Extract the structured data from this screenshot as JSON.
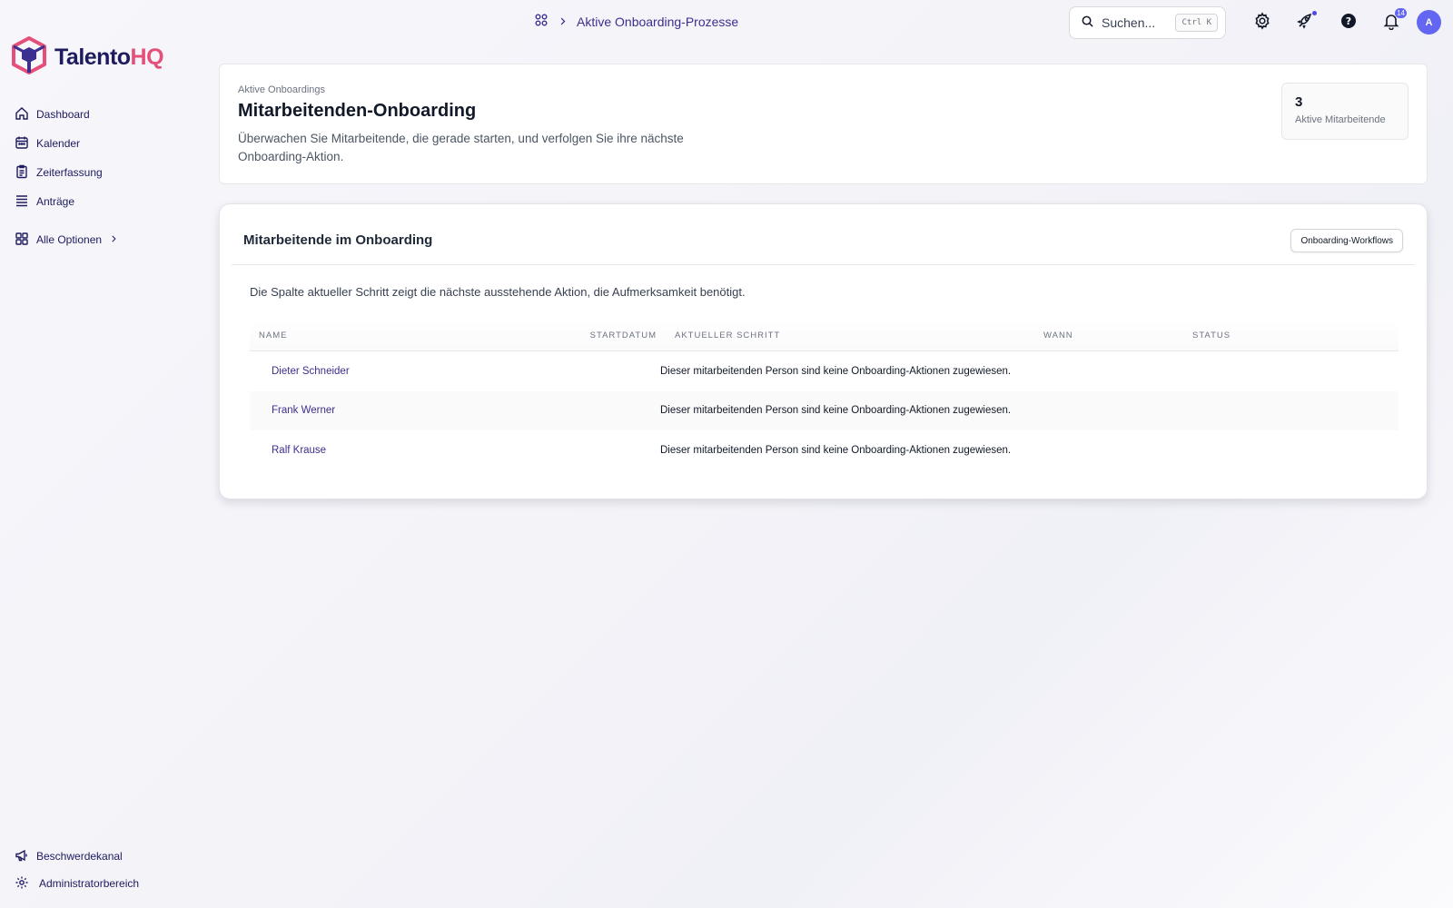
{
  "brand": {
    "name_part1": "Talento",
    "name_part2": "HQ",
    "primary": "#1e1b5e",
    "accent": "#e4507a"
  },
  "sidebar": {
    "items": [
      {
        "label": "Dashboard",
        "icon": "home-icon"
      },
      {
        "label": "Kalender",
        "icon": "calendar-icon"
      },
      {
        "label": "Zeiterfassung",
        "icon": "timesheet-icon"
      },
      {
        "label": "Anträge",
        "icon": "list-icon"
      }
    ],
    "all_options": {
      "label": "Alle Optionen",
      "icon": "grid-icon"
    },
    "bottom": [
      {
        "label": "Beschwerdekanal",
        "icon": "megaphone-icon"
      },
      {
        "label": "Administratorbereich",
        "icon": "gear-icon"
      }
    ]
  },
  "topbar": {
    "breadcrumb": {
      "current": "Aktive Onboarding-Prozesse"
    },
    "search": {
      "placeholder": "Suchen...",
      "shortcut": "Ctrl K"
    },
    "notifications_count": "14",
    "avatar_initial": "A"
  },
  "header": {
    "eyebrow": "Aktive Onboardings",
    "title": "Mitarbeitenden-Onboarding",
    "description": "Überwachen Sie Mitarbeitende, die gerade starten, und verfolgen Sie ihre nächste Onboarding-Aktion.",
    "stat": {
      "value": "3",
      "label": "Aktive Mitarbeitende"
    }
  },
  "list": {
    "title": "Mitarbeitende im Onboarding",
    "workflows_button": "Onboarding-Workflows",
    "hint": "Die Spalte aktueller Schritt zeigt die nächste ausstehende Aktion, die Aufmerksamkeit benötigt.",
    "columns": {
      "name": "NAME",
      "start": "STARTDATUM",
      "step": "AKTUELLER SCHRITT",
      "when": "WANN",
      "status": "STATUS"
    },
    "rows": [
      {
        "name": "Dieter Schneider",
        "start": "",
        "step": "Dieser mitarbeitenden Person sind keine Onboarding-Aktionen zugewiesen.",
        "when": "",
        "status": ""
      },
      {
        "name": "Frank Werner",
        "start": "",
        "step": "Dieser mitarbeitenden Person sind keine Onboarding-Aktionen zugewiesen.",
        "when": "",
        "status": ""
      },
      {
        "name": "Ralf Krause",
        "start": "",
        "step": "Dieser mitarbeitenden Person sind keine Onboarding-Aktionen zugewiesen.",
        "when": "",
        "status": ""
      }
    ]
  }
}
